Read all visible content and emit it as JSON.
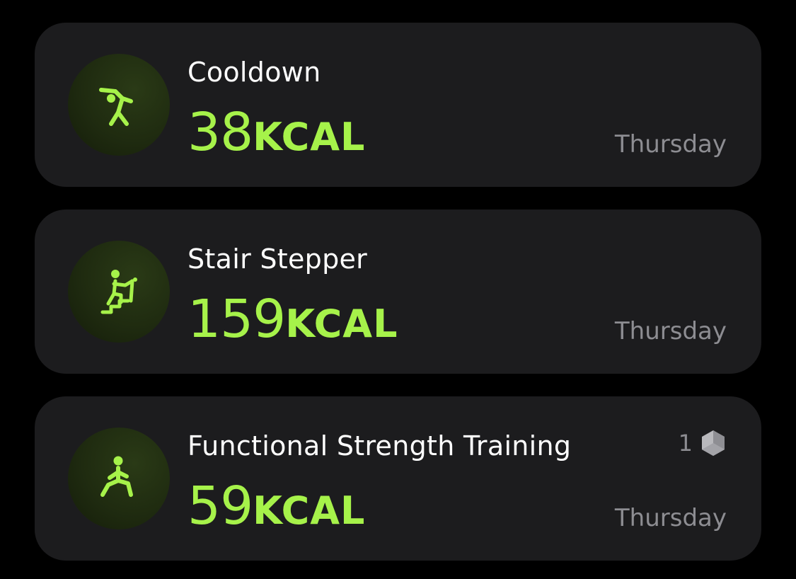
{
  "colors": {
    "background": "#000000",
    "card": "#1c1c1e",
    "accent": "#a6f24a",
    "secondary_text": "#8d8d92"
  },
  "workouts": [
    {
      "icon": "cooldown-stretch-icon",
      "title": "Cooldown",
      "calories": "38",
      "unit": "KCAL",
      "day": "Thursday"
    },
    {
      "icon": "stair-stepper-icon",
      "title": "Stair Stepper",
      "calories": "159",
      "unit": "KCAL",
      "day": "Thursday"
    },
    {
      "icon": "functional-strength-icon",
      "title": "Functional Strength Training",
      "calories": "59",
      "unit": "KCAL",
      "day": "Thursday",
      "badge": {
        "count": "1",
        "icon": "award-hexagon-icon"
      }
    }
  ]
}
